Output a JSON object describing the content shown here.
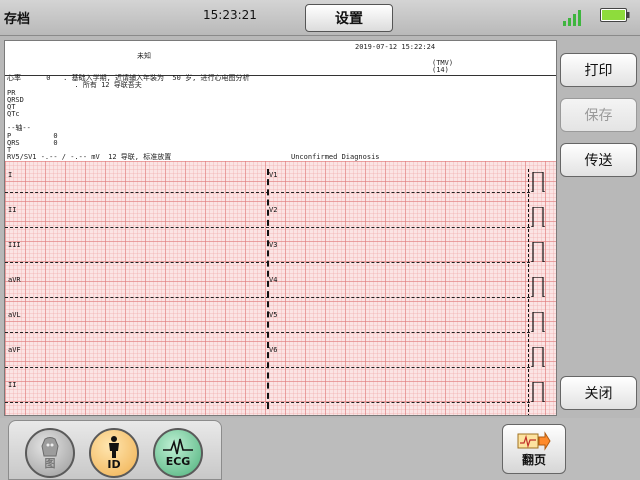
{
  "topbar": {
    "title": "存档",
    "time": "15:23:21",
    "settings_label": "设置",
    "signal_icon": "signal-bars-icon",
    "battery_icon": "battery-icon",
    "accent_green": "#3fb63f"
  },
  "report": {
    "name": "未知",
    "datetime": "2019-07-12 15:22:24",
    "tmv": "(TMV)",
    "tmv_value": "(14)",
    "hr_line": "心率      0   . 基础入学期, 近请辅入年装为  50 岁, 进行心电图分析",
    "hr_line2": "                . 所有 12 导联吾夫",
    "params": [
      "PR",
      "QRSD",
      "QT",
      "QTc"
    ],
    "axis_header": "--轴--",
    "axis_rows": [
      "P          0",
      "QRS        0",
      "T"
    ],
    "rv5_line": "RV5/SV1 -.-- / -.-- mV  12 导联, 标准放置",
    "diagnosis": "Unconfirmed Diagnosis"
  },
  "leads": {
    "left": [
      "I",
      "II",
      "III",
      "aVR",
      "aVL",
      "aVF",
      "II"
    ],
    "right": [
      "V1",
      "V2",
      "V3",
      "V4",
      "V5",
      "V6"
    ]
  },
  "sidebar": {
    "print_label": "打印",
    "save_label": "保存",
    "send_label": "传送",
    "close_label": "关闭"
  },
  "bottombar": {
    "image_label": "图",
    "id_label": "ID",
    "ecg_label": "ECG",
    "page_label": "翻页"
  },
  "colors": {
    "grid_bg": "#fbe4e4",
    "grid_line": "#e07878"
  }
}
